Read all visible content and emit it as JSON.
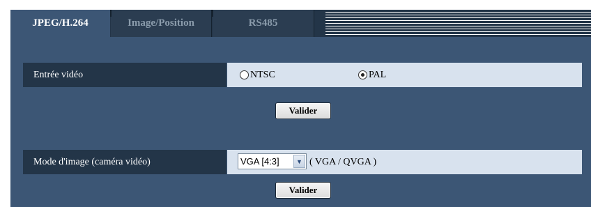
{
  "tabs": [
    {
      "label": "JPEG/H.264",
      "active": true
    },
    {
      "label": "Image/Position",
      "active": false
    },
    {
      "label": "RS485",
      "active": false
    }
  ],
  "video_input": {
    "label": "Entrée vidéo",
    "options": [
      {
        "label": "NTSC",
        "selected": false
      },
      {
        "label": "PAL",
        "selected": true
      }
    ],
    "submit_label": "Valider"
  },
  "image_mode": {
    "label": "Mode d'image (caméra vidéo)",
    "select_value": "VGA [4:3]",
    "suffix": "( VGA / QVGA )",
    "submit_label": "Valider"
  },
  "icons": {
    "select_arrow": "chevron-down-icon"
  },
  "colors": {
    "tab_strip": "#233548",
    "panel": "#3c5675",
    "label_cell": "#233548",
    "value_cell": "#d8e2ee"
  }
}
